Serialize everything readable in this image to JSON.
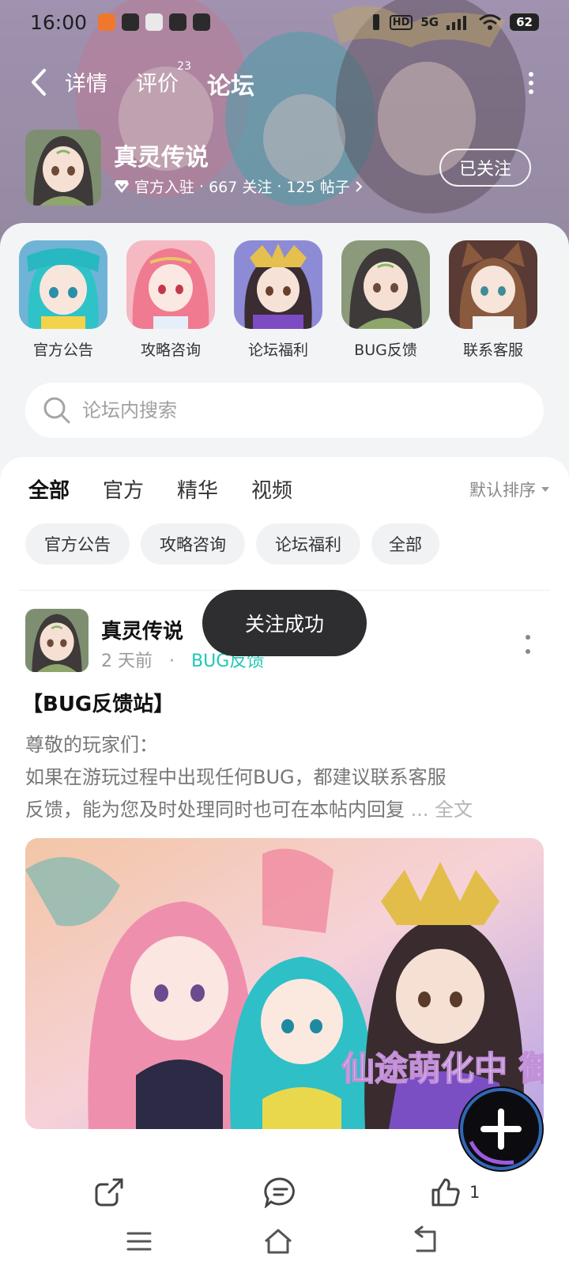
{
  "status_bar": {
    "time": "16:00",
    "network": "5G",
    "hd_label": "HD",
    "battery": "62"
  },
  "nav": {
    "tabs": [
      {
        "label": "详情",
        "active": false
      },
      {
        "label": "评价",
        "active": false,
        "badge": "23"
      },
      {
        "label": "论坛",
        "active": true
      }
    ]
  },
  "game": {
    "name": "真灵传说",
    "official": "官方入驻",
    "followers": "667 关注",
    "posts": "125 帖子",
    "follow_label": "已关注"
  },
  "quick_links": [
    {
      "label": "官方公告",
      "icon": "cyan-hair-character"
    },
    {
      "label": "攻略咨询",
      "icon": "pink-hair-character"
    },
    {
      "label": "论坛福利",
      "icon": "crowned-character"
    },
    {
      "label": "BUG反馈",
      "icon": "green-robe-character"
    },
    {
      "label": "联系客服",
      "icon": "cat-ear-character"
    }
  ],
  "search": {
    "placeholder": "论坛内搜索"
  },
  "filter_tabs": [
    {
      "label": "全部",
      "active": true
    },
    {
      "label": "官方",
      "active": false
    },
    {
      "label": "精华",
      "active": false
    },
    {
      "label": "视频",
      "active": false
    }
  ],
  "sort": {
    "label": "默认排序"
  },
  "chips": [
    "官方公告",
    "攻略咨询",
    "论坛福利",
    "全部"
  ],
  "post": {
    "author": "真灵传说",
    "time": "2 天前",
    "separator": "·",
    "category": "BUG反馈",
    "title": "【BUG反馈站】",
    "body_lines": [
      "尊敬的玩家们：",
      " 如果在游玩过程中出现任何BUG，都建议联系客服",
      "反馈，能为您及时处理同时也可在本帖内回复"
    ],
    "ellipsis": " ...",
    "more_label": " 全文",
    "banner_text": "仙途萌化中 御剑恰",
    "likes": "1"
  },
  "toast": "关注成功",
  "colors": {
    "accent": "#23d3c4",
    "category": "#1fc7b6",
    "toast_bg": "#2e2e30"
  }
}
